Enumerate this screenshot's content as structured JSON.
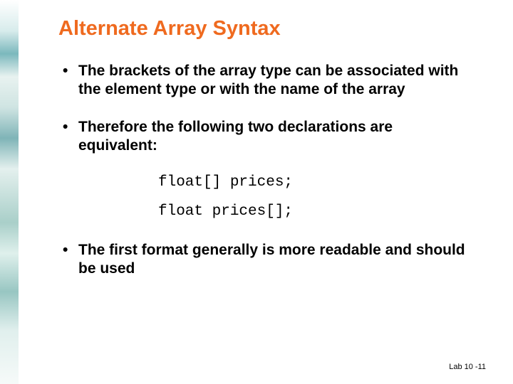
{
  "title": "Alternate Array Syntax",
  "bullets": {
    "b1": "The brackets of the array type can be associated with the element type or with the name of the array",
    "b2": "Therefore the following two declarations are equivalent:",
    "b3": "The first format generally is more readable and should be used"
  },
  "code": {
    "line1": "float[] prices;",
    "line2": "float prices[];"
  },
  "footer": "Lab 10 -11"
}
